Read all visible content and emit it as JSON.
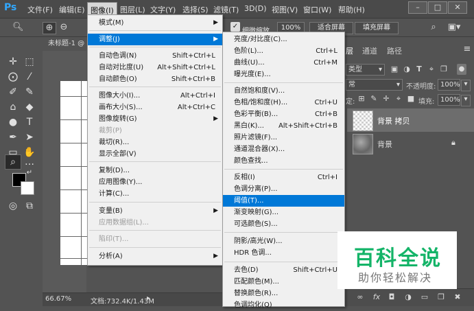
{
  "app": {
    "logo": "Ps"
  },
  "menubar": {
    "items": [
      "文件(F)",
      "编辑(E)",
      "图像(I)",
      "图层(L)",
      "文字(Y)",
      "选择(S)",
      "滤镜(T)",
      "3D(D)",
      "视图(V)",
      "窗口(W)",
      "帮助(H)"
    ],
    "window_buttons": [
      "–",
      "□",
      "✕"
    ]
  },
  "options": {
    "fine_zoom_label": "细微缩放",
    "zoom_value": "100%",
    "fit_screen": "适合屏幕",
    "fill_screen": "填充屏幕"
  },
  "document": {
    "tab_label": "未标题-1 @"
  },
  "status": {
    "zoom": "66.67%",
    "doc_info": "文档:732.4K/1.43M"
  },
  "panel": {
    "tabs": [
      "层",
      "通道",
      "路径"
    ],
    "kind_label": "类型",
    "blend_mode": "常",
    "opacity_label": "不透明度:",
    "opacity_value": "100%",
    "lock_label": "定:",
    "fill_label": "填充:",
    "fill_value": "100%",
    "layers": [
      {
        "name": "背景 拷贝"
      },
      {
        "name": "背景"
      }
    ]
  },
  "image_menu": {
    "items": [
      {
        "label": "模式(M)",
        "submenu": true
      },
      {
        "label": "调整(J)",
        "submenu": true,
        "highlight": true
      },
      {
        "label": "自动色调(N)",
        "shortcut": "Shift+Ctrl+L"
      },
      {
        "label": "自动对比度(U)",
        "shortcut": "Alt+Shift+Ctrl+L"
      },
      {
        "label": "自动颜色(O)",
        "shortcut": "Shift+Ctrl+B"
      },
      {
        "label": "图像大小(I)...",
        "shortcut": "Alt+Ctrl+I"
      },
      {
        "label": "画布大小(S)...",
        "shortcut": "Alt+Ctrl+C"
      },
      {
        "label": "图像旋转(G)",
        "submenu": true
      },
      {
        "label": "裁剪(P)",
        "disabled": true
      },
      {
        "label": "裁切(R)..."
      },
      {
        "label": "显示全部(V)"
      },
      {
        "label": "复制(D)..."
      },
      {
        "label": "应用图像(Y)..."
      },
      {
        "label": "计算(C)..."
      },
      {
        "label": "变量(B)",
        "submenu": true
      },
      {
        "label": "应用数据组(L)...",
        "disabled": true
      },
      {
        "label": "陷印(T)...",
        "disabled": true
      },
      {
        "label": "分析(A)",
        "submenu": true
      }
    ]
  },
  "adjust_menu": {
    "items": [
      {
        "label": "亮度/对比度(C)..."
      },
      {
        "label": "色阶(L)...",
        "shortcut": "Ctrl+L"
      },
      {
        "label": "曲线(U)...",
        "shortcut": "Ctrl+M"
      },
      {
        "label": "曝光度(E)..."
      },
      {
        "label": "自然饱和度(V)..."
      },
      {
        "label": "色相/饱和度(H)...",
        "shortcut": "Ctrl+U"
      },
      {
        "label": "色彩平衡(B)...",
        "shortcut": "Ctrl+B"
      },
      {
        "label": "黑白(K)...",
        "shortcut": "Alt+Shift+Ctrl+B"
      },
      {
        "label": "照片滤镜(F)..."
      },
      {
        "label": "通道混合器(X)..."
      },
      {
        "label": "颜色查找..."
      },
      {
        "label": "反相(I)",
        "shortcut": "Ctrl+I"
      },
      {
        "label": "色调分离(P)..."
      },
      {
        "label": "阈值(T)...",
        "highlight": true
      },
      {
        "label": "渐变映射(G)..."
      },
      {
        "label": "可选颜色(S)..."
      },
      {
        "label": "阴影/高光(W)..."
      },
      {
        "label": "HDR 色调..."
      },
      {
        "label": "去色(D)",
        "shortcut": "Shift+Ctrl+U"
      },
      {
        "label": "匹配颜色(M)..."
      },
      {
        "label": "替换颜色(R)..."
      },
      {
        "label": "色调均化(Q)"
      }
    ]
  },
  "watermark": {
    "title": "百科全说",
    "subtitle": "助你轻松解决"
  },
  "colors": {
    "highlight": "#0078d7",
    "watermark_green": "#14b468",
    "ps_blue": "#31a8ff"
  }
}
